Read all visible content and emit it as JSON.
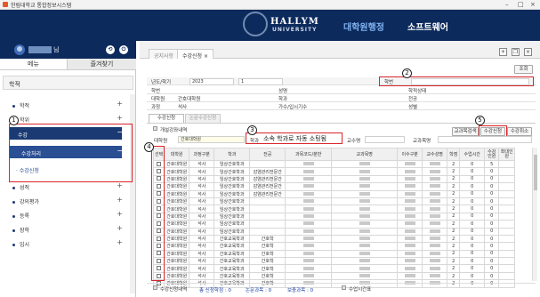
{
  "window": {
    "title": "한림대학교 통합정보시스템"
  },
  "header": {
    "logo_main": "HALLYM",
    "logo_sub": "UNIVERSITY",
    "menu": [
      "대학원행정",
      "소프트웨어"
    ]
  },
  "sidebar": {
    "user_suffix": "님",
    "tabs": [
      "메뉴",
      "즐겨찾기"
    ],
    "section_title": "학적",
    "items": [
      {
        "label": "학적",
        "sign": "+"
      },
      {
        "label": "학위",
        "sign": "+"
      },
      {
        "label": "수강",
        "sign": "−"
      },
      {
        "label": "수강처리",
        "sign": "−"
      },
      {
        "label": "수강신청",
        "sign": ""
      },
      {
        "label": "성적",
        "sign": "+"
      },
      {
        "label": "강의평가",
        "sign": "+"
      },
      {
        "label": "등록",
        "sign": "+"
      },
      {
        "label": "장학",
        "sign": "+"
      },
      {
        "label": "입시",
        "sign": "+"
      }
    ]
  },
  "tabs": {
    "inactive": "공지사항",
    "active": "수강신청",
    "close": "×"
  },
  "toolbar": {
    "search_label": "조회"
  },
  "form": {
    "year_label": "년도/학기",
    "year_value": "2023",
    "term_value": "1",
    "student_id_label": "학번",
    "row2": [
      "학번",
      "성명",
      "학적상태"
    ],
    "row3": [
      "대학원",
      "간호대학원",
      "학과",
      "전공"
    ],
    "row4": [
      "과정",
      "석사",
      "가수/입시기수",
      "성별"
    ]
  },
  "subtabs": [
    "수강신청",
    "논문수강신청"
  ],
  "courses_header": "개설강좌내역",
  "buttons": {
    "search": "교과목검색",
    "apply": "수강신청",
    "cancel": "수강취소"
  },
  "filters": {
    "grad_label": "대학원",
    "grad_value": "간호대학원",
    "dept_label": "학과",
    "dept_value": "소속 학과로 자동 소팅됨",
    "prof_label": "교수명",
    "course_label": "교과목명"
  },
  "annotations": [
    "1",
    "2",
    "3",
    "4",
    "5"
  ],
  "table": {
    "columns": [
      "선택",
      "대학원",
      "과정구분",
      "학과",
      "전공",
      "과목코드/분반",
      "교과목명",
      "이수구분",
      "교수성명",
      "학점",
      "수업시간",
      "수강인원",
      "최대인원"
    ],
    "rows": [
      {
        "grad": "간호대학원",
        "level": "석사",
        "dept": "임상간호학과",
        "major": "",
        "course": "",
        "credit": "2",
        "hours": "0",
        "enrolled": "5"
      },
      {
        "grad": "간호대학원",
        "level": "석사",
        "dept": "임상간호학과",
        "major": "감염관리전문간",
        "course": "",
        "credit": "2",
        "hours": "0",
        "enrolled": "0"
      },
      {
        "grad": "간호대학원",
        "level": "석사",
        "dept": "임상간호학과",
        "major": "감염관리전문간",
        "course": "",
        "credit": "2",
        "hours": "0",
        "enrolled": "0"
      },
      {
        "grad": "간호대학원",
        "level": "석사",
        "dept": "임상간호학과",
        "major": "감염관리전문간",
        "course": "",
        "credit": "2",
        "hours": "0",
        "enrolled": "0"
      },
      {
        "grad": "간호대학원",
        "level": "석사",
        "dept": "임상간호학과",
        "major": "감염관리전문간",
        "course": "",
        "credit": "2",
        "hours": "0",
        "enrolled": "0"
      },
      {
        "grad": "간호대학원",
        "level": "석사",
        "dept": "임상간호학과",
        "major": "",
        "course": "",
        "credit": "2",
        "hours": "0",
        "enrolled": "0"
      },
      {
        "grad": "간호대학원",
        "level": "석사",
        "dept": "임상간호학과",
        "major": "",
        "course": "",
        "credit": "2",
        "hours": "0",
        "enrolled": "0"
      },
      {
        "grad": "간호대학원",
        "level": "석사",
        "dept": "임상간호학과",
        "major": "",
        "course": "",
        "credit": "2",
        "hours": "0",
        "enrolled": "0"
      },
      {
        "grad": "간호대학원",
        "level": "석사",
        "dept": "임상간호학과",
        "major": "",
        "course": "",
        "credit": "2",
        "hours": "0",
        "enrolled": "0"
      },
      {
        "grad": "간호대학원",
        "level": "석사",
        "dept": "임상간호학과",
        "major": "",
        "course": "",
        "credit": "2",
        "hours": "0",
        "enrolled": "0"
      },
      {
        "grad": "간호대학원",
        "level": "석사",
        "dept": "간호교육학과",
        "major": "간호학",
        "course": "",
        "credit": "2",
        "hours": "0",
        "enrolled": "0"
      },
      {
        "grad": "간호대학원",
        "level": "석사",
        "dept": "간호교육학과",
        "major": "간호학",
        "course": "",
        "credit": "2",
        "hours": "0",
        "enrolled": "0"
      },
      {
        "grad": "간호대학원",
        "level": "석사",
        "dept": "간호교육학과",
        "major": "간호학",
        "course": "",
        "credit": "2",
        "hours": "0",
        "enrolled": "0"
      },
      {
        "grad": "간호대학원",
        "level": "석사",
        "dept": "간호교육학과",
        "major": "간호학",
        "course": "",
        "credit": "2",
        "hours": "0",
        "enrolled": "0"
      },
      {
        "grad": "간호대학원",
        "level": "석사",
        "dept": "간호교육학과",
        "major": "간호학",
        "course": "",
        "credit": "2",
        "hours": "0",
        "enrolled": "0"
      },
      {
        "grad": "간호대학원",
        "level": "석사",
        "dept": "간호교육학과",
        "major": "간호학",
        "course": "",
        "credit": "2",
        "hours": "0",
        "enrolled": "0"
      },
      {
        "grad": "간호대학원",
        "level": "석사",
        "dept": "간호교육학과",
        "major": "간호학",
        "course": "",
        "credit": "2",
        "hours": "0",
        "enrolled": "0"
      }
    ]
  },
  "footer": {
    "history": "수강신청내역",
    "total": "총 신청학점 : 0",
    "thesis": "논문과목 : 0",
    "supplement": "보충과목 : 0",
    "time": "수업시간표"
  }
}
